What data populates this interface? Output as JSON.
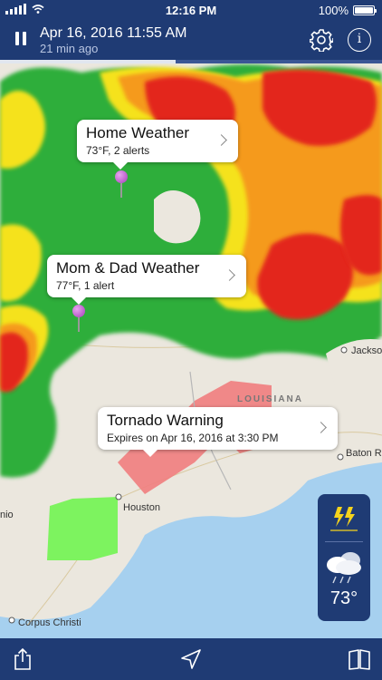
{
  "status_bar": {
    "time": "12:16 PM",
    "battery_text": "100%",
    "battery_level": 1.0,
    "signal_icon": "cell-signal-icon",
    "wifi_icon": "wifi-icon"
  },
  "header": {
    "title": "Apr 16, 2016 11:55 AM",
    "subtitle": "21 min ago",
    "loop_progress": 0.46,
    "pause_icon": "pause-icon",
    "settings_icon": "gear-icon",
    "info_icon": "info-icon",
    "info_glyph": "i"
  },
  "map": {
    "place_labels": {
      "houston": "Houston",
      "baton_rouge": "Baton Rou",
      "jackson": "Jackso",
      "corpus_christi": "Corpus Christi",
      "san_antonio": "nio",
      "louisiana": "LOUISIANA"
    },
    "callouts": [
      {
        "title": "Home Weather",
        "subtitle": "73°F, 2 alerts"
      },
      {
        "title": "Mom & Dad Weather",
        "subtitle": "77°F, 1 alert"
      },
      {
        "title": "Tornado Warning",
        "subtitle": "Expires on Apr 16, 2016 at 3:30 PM"
      }
    ],
    "colors": {
      "radar_green": "#2fae3a",
      "radar_yellow": "#f5e21d",
      "radar_orange": "#f59a1c",
      "radar_red": "#e3261f",
      "tornado_warning": "#f08080",
      "flood_warning": "#7df35f",
      "water": "#a6d0ef"
    }
  },
  "weather_widget": {
    "alert_icon": "lightning-alert-icon",
    "condition_icon": "rain-cloud-icon",
    "temperature": "73°"
  },
  "toolbar": {
    "share_icon": "share-icon",
    "location_icon": "location-arrow-icon",
    "map_icon": "map-book-icon"
  },
  "theme": {
    "bar_color": "#1f3b74",
    "text_color": "#ffffff"
  }
}
